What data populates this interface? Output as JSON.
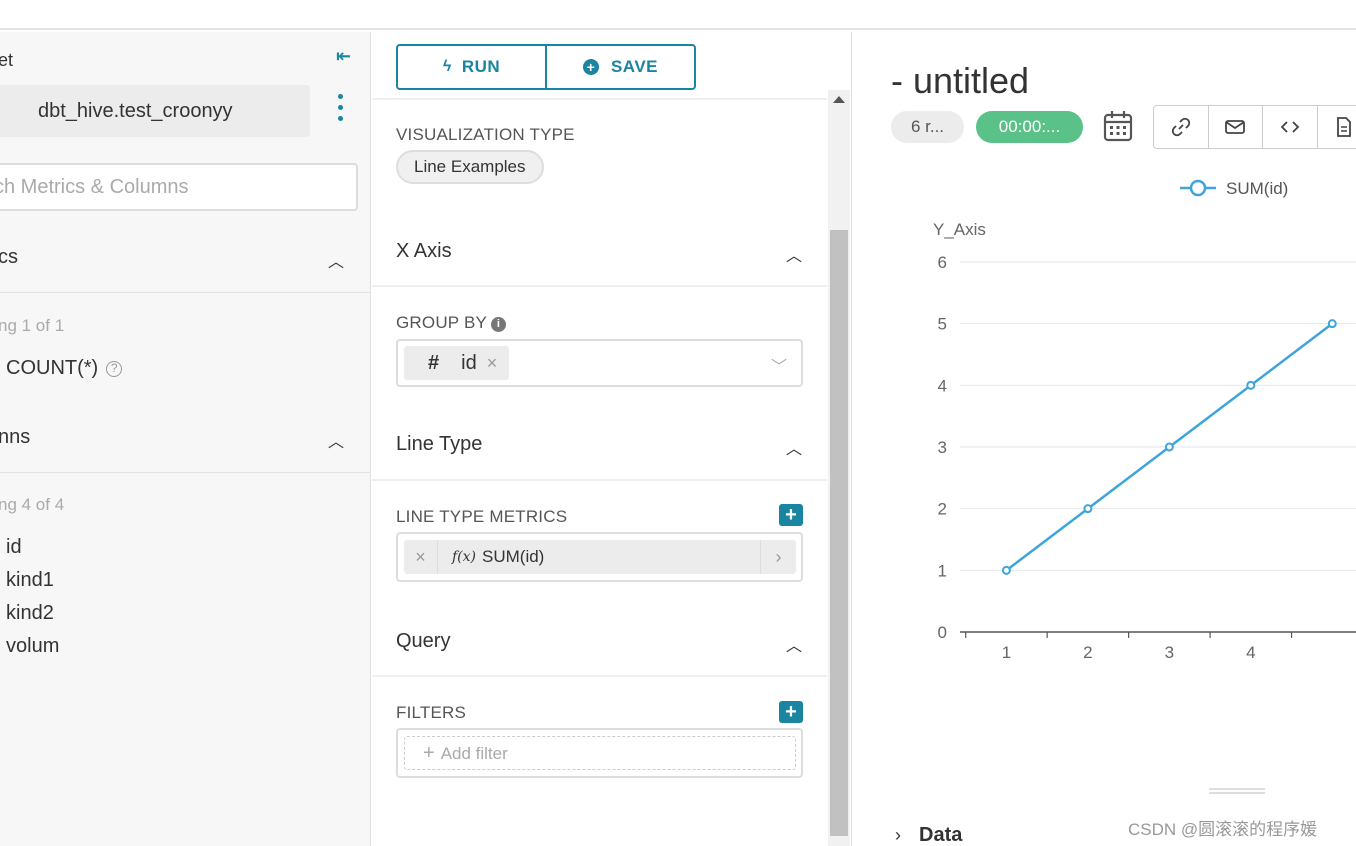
{
  "left": {
    "dataset_label": "et",
    "dataset_name": "dbt_hive.test_croonyy",
    "search_placeholder": "ch Metrics & Columns",
    "metrics_title": "cs",
    "metrics_showing": "ng 1 of 1",
    "metrics": [
      "COUNT(*)"
    ],
    "columns_title": "nns",
    "columns_showing": "ng 4 of 4",
    "columns": [
      "id",
      "kind1",
      "kind2",
      "volum"
    ]
  },
  "toolbar": {
    "run_label": "RUN",
    "save_label": "SAVE"
  },
  "controls": {
    "viz_type_label": "VISUALIZATION TYPE",
    "viz_type_value": "Line Examples",
    "x_axis_title": "X Axis",
    "group_by_label": "GROUP BY",
    "group_by_value": "id",
    "line_type_title": "Line Type",
    "line_type_metrics_label": "LINE TYPE METRICS",
    "metric_value": "SUM(id)",
    "metric_fx": "f(x)",
    "query_title": "Query",
    "filters_label": "FILTERS",
    "add_filter": "Add filter"
  },
  "header": {
    "title": "- untitled",
    "rows_badge": "6 r...",
    "timer_badge": "00:00:..."
  },
  "data_section": {
    "label": "Data"
  },
  "watermark": "CSDN @圆滚滚的程序媛",
  "colors": {
    "accent": "#1a85a0",
    "success": "#5ac189",
    "series": "#3da5dc"
  },
  "chart_data": {
    "type": "line",
    "legend": "SUM(id)",
    "ylabel": "Y_Axis",
    "xlabel": "",
    "x": [
      1,
      2,
      3,
      4,
      5
    ],
    "series": [
      {
        "name": "SUM(id)",
        "values": [
          1,
          2,
          3,
          4,
          5
        ]
      }
    ],
    "ylim": [
      0,
      6
    ],
    "yticks": [
      0,
      1,
      2,
      3,
      4,
      5,
      6
    ],
    "xticks": [
      1,
      2,
      3,
      4
    ],
    "grid": true,
    "legend_position": "top"
  }
}
